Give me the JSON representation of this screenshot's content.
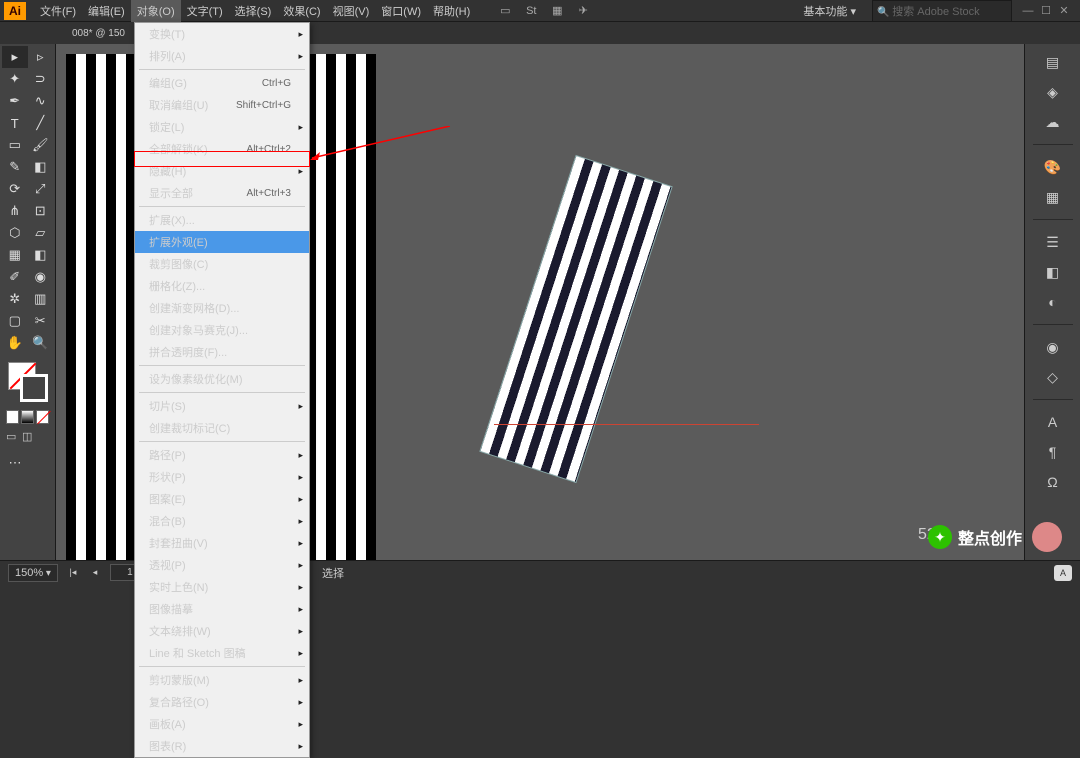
{
  "app": {
    "logo": "Ai"
  },
  "menubar": {
    "items": [
      "文件(F)",
      "编辑(E)",
      "对象(O)",
      "文字(T)",
      "选择(S)",
      "效果(C)",
      "视图(V)",
      "窗口(W)",
      "帮助(H)"
    ],
    "active_index": 2,
    "workspace": "基本功能",
    "search_placeholder": "搜索 Adobe Stock"
  },
  "doc_tab": "008* @ 150",
  "dropdown": {
    "items": [
      {
        "label": "变换(T)",
        "sub": true
      },
      {
        "label": "排列(A)",
        "sub": true
      },
      {
        "sep": true
      },
      {
        "label": "编组(G)",
        "shortcut": "Ctrl+G",
        "disabled": true
      },
      {
        "label": "取消编组(U)",
        "shortcut": "Shift+Ctrl+G"
      },
      {
        "label": "锁定(L)",
        "sub": true
      },
      {
        "label": "全部解锁(K)",
        "shortcut": "Alt+Ctrl+2"
      },
      {
        "label": "隐藏(H)",
        "sub": true
      },
      {
        "label": "显示全部",
        "shortcut": "Alt+Ctrl+3",
        "disabled": true
      },
      {
        "sep": true
      },
      {
        "label": "扩展(X)...",
        "disabled": true
      },
      {
        "label": "扩展外观(E)",
        "highlighted": true
      },
      {
        "label": "裁剪图像(C)",
        "disabled": true
      },
      {
        "label": "栅格化(Z)...",
        "disabled": false
      },
      {
        "label": "创建渐变网格(D)..."
      },
      {
        "label": "创建对象马赛克(J)...",
        "disabled": true
      },
      {
        "label": "拼合透明度(F)..."
      },
      {
        "sep": true
      },
      {
        "label": "设为像素级优化(M)"
      },
      {
        "sep": true
      },
      {
        "label": "切片(S)",
        "sub": true
      },
      {
        "label": "创建裁切标记(C)"
      },
      {
        "sep": true
      },
      {
        "label": "路径(P)",
        "sub": true
      },
      {
        "label": "形状(P)",
        "sub": true
      },
      {
        "label": "图案(E)",
        "sub": true
      },
      {
        "label": "混合(B)",
        "sub": true
      },
      {
        "label": "封套扭曲(V)",
        "sub": true
      },
      {
        "label": "透视(P)",
        "sub": true
      },
      {
        "label": "实时上色(N)",
        "sub": true
      },
      {
        "label": "图像描摹",
        "sub": true
      },
      {
        "label": "文本绕排(W)",
        "sub": true
      },
      {
        "label": "Line 和 Sketch 图稿",
        "sub": true
      },
      {
        "sep": true
      },
      {
        "label": "剪切蒙版(M)",
        "sub": true
      },
      {
        "label": "复合路径(O)",
        "sub": true
      },
      {
        "label": "画板(A)",
        "sub": true
      },
      {
        "label": "图表(R)",
        "sub": true
      }
    ]
  },
  "right_panel": {
    "letter": "A",
    "omega": "Ω"
  },
  "status": {
    "zoom": "150%",
    "page": "1",
    "artboard": "1",
    "mode": "选择"
  },
  "zoom_badge": "52%",
  "watermark": {
    "text": "整点创作"
  }
}
